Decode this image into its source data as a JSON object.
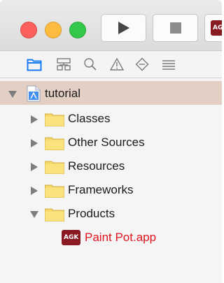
{
  "toolbar": {
    "traffic_lights": [
      {
        "name": "close",
        "color": "#fc605c"
      },
      {
        "name": "minimize",
        "color": "#fdbc40"
      },
      {
        "name": "zoom",
        "color": "#34c84a"
      }
    ],
    "run_icon": "play-icon",
    "stop_icon": "stop-icon",
    "scheme_badge": "AG"
  },
  "navigator": {
    "icons": [
      "folder-icon",
      "hierarchy-icon",
      "search-icon",
      "warning-icon",
      "breakpoint-diamond-icon",
      "list-icon"
    ],
    "active_color": "#1a7cf5"
  },
  "tree": {
    "project": {
      "label": "tutorial",
      "expanded": true
    },
    "groups": [
      {
        "label": "Classes",
        "expanded": false
      },
      {
        "label": "Other Sources",
        "expanded": false
      },
      {
        "label": "Resources",
        "expanded": false
      },
      {
        "label": "Frameworks",
        "expanded": false
      },
      {
        "label": "Products",
        "expanded": true
      }
    ],
    "product": {
      "badge": "AGK",
      "label": "Paint Pot.app",
      "color": "#e0141e"
    }
  },
  "colors": {
    "selection": "#e3cfc4",
    "folder": "#f5d66b"
  }
}
